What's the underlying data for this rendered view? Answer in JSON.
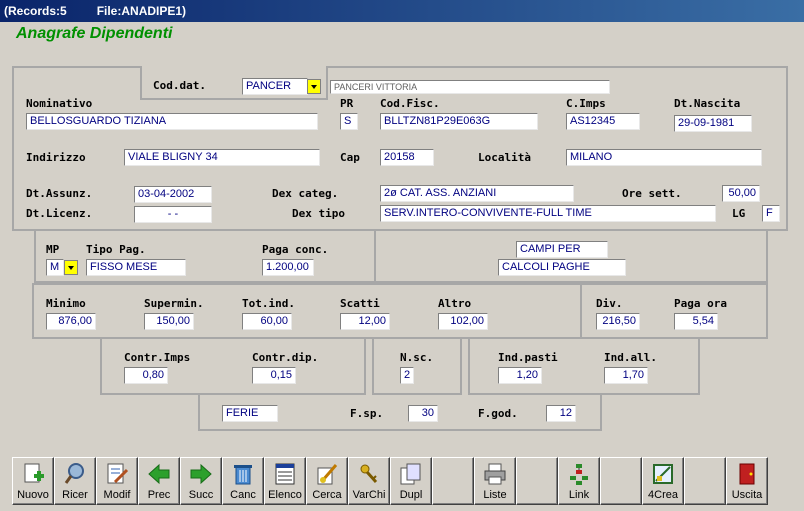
{
  "window": {
    "records": "(Records:5",
    "file": "File:ANADIPE1)"
  },
  "app_title": "Anagrafe Dipendenti",
  "header": {
    "cod_dat_label": "Cod.dat.",
    "cod_dat_value": "PANCER",
    "cod_dat_desc": "PANCERI VITTORIA"
  },
  "person": {
    "nominativo_label": "Nominativo",
    "nominativo": "BELLOSGUARDO TIZIANA",
    "pr_label": "PR",
    "pr": "S",
    "codfisc_label": "Cod.Fisc.",
    "codfisc": "BLLTZN81P29E063G",
    "cinps_label": "C.Imps",
    "cinps": "AS12345",
    "dtnascita_label": "Dt.Nascita",
    "dtnascita": "29-09-1981",
    "indirizzo_label": "Indirizzo",
    "indirizzo": "VIALE BLIGNY 34",
    "cap_label": "Cap",
    "cap": "20158",
    "localita_label": "Località",
    "localita": "MILANO",
    "dtassunz_label": "Dt.Assunz.",
    "dtassunz": "03-04-2002",
    "dtlicenz_label": "Dt.Licenz.",
    "dtlicenz": "-   -",
    "dexcateg_label": "Dex categ.",
    "dexcateg": "2ø CAT. ASS. ANZIANI",
    "dextipo_label": "Dex tipo",
    "dextipo": "SERV.INTERO-CONVIVENTE-FULL TIME",
    "oresett_label": "Ore sett.",
    "oresett": "50,00",
    "lg_label": "LG",
    "lg": "F"
  },
  "pay": {
    "mp_label": "MP",
    "mp": "M",
    "tipopag_label": "Tipo Pag.",
    "tipopag": "FISSO MESE",
    "pagaconc_label": "Paga conc.",
    "pagaconc": "1.200,00",
    "campi_per": "CAMPI PER",
    "calcoli_paghe": "CALCOLI PAGHE"
  },
  "amounts": {
    "minimo_label": "Minimo",
    "minimo": "876,00",
    "supermin_label": "Supermin.",
    "supermin": "150,00",
    "totind_label": "Tot.ind.",
    "totind": "60,00",
    "scatti_label": "Scatti",
    "scatti": "12,00",
    "altro_label": "Altro",
    "altro": "102,00",
    "div_label": "Div.",
    "div": "216,50",
    "pagaora_label": "Paga ora",
    "pagaora": "5,54"
  },
  "contrib": {
    "contrinps_label": "Contr.Imps",
    "contrinps": "0,80",
    "contrdip_label": "Contr.dip.",
    "contrdip": "0,15",
    "nsc_label": "N.sc.",
    "nsc": "2",
    "indpasti_label": "Ind.pasti",
    "indpasti": "1,20",
    "indall_label": "Ind.all.",
    "indall": "1,70"
  },
  "ferie": {
    "ferie": "FERIE",
    "fsp_label": "F.sp.",
    "fsp": "30",
    "fgod_label": "F.god.",
    "fgod": "12"
  },
  "toolbar": [
    {
      "label": "Nuovo",
      "icon": "new-doc-icon"
    },
    {
      "label": "Ricer",
      "icon": "magnifier-icon"
    },
    {
      "label": "Modif",
      "icon": "edit-doc-icon"
    },
    {
      "label": "Prec",
      "icon": "arrow-left-icon"
    },
    {
      "label": "Succ",
      "icon": "arrow-right-icon"
    },
    {
      "label": "Canc",
      "icon": "trash-icon"
    },
    {
      "label": "Elenco",
      "icon": "list-icon"
    },
    {
      "label": "Cerca",
      "icon": "search-brush-icon"
    },
    {
      "label": "VarChi",
      "icon": "keys-icon"
    },
    {
      "label": "Dupl",
      "icon": "duplicate-icon"
    },
    {
      "label": "",
      "icon": ""
    },
    {
      "label": "Liste",
      "icon": "printer-icon"
    },
    {
      "label": "",
      "icon": ""
    },
    {
      "label": "Link",
      "icon": "link-icon"
    },
    {
      "label": "",
      "icon": ""
    },
    {
      "label": "4Crea",
      "icon": "create-icon"
    },
    {
      "label": "",
      "icon": ""
    },
    {
      "label": "Uscita",
      "icon": "exit-door-icon"
    }
  ]
}
